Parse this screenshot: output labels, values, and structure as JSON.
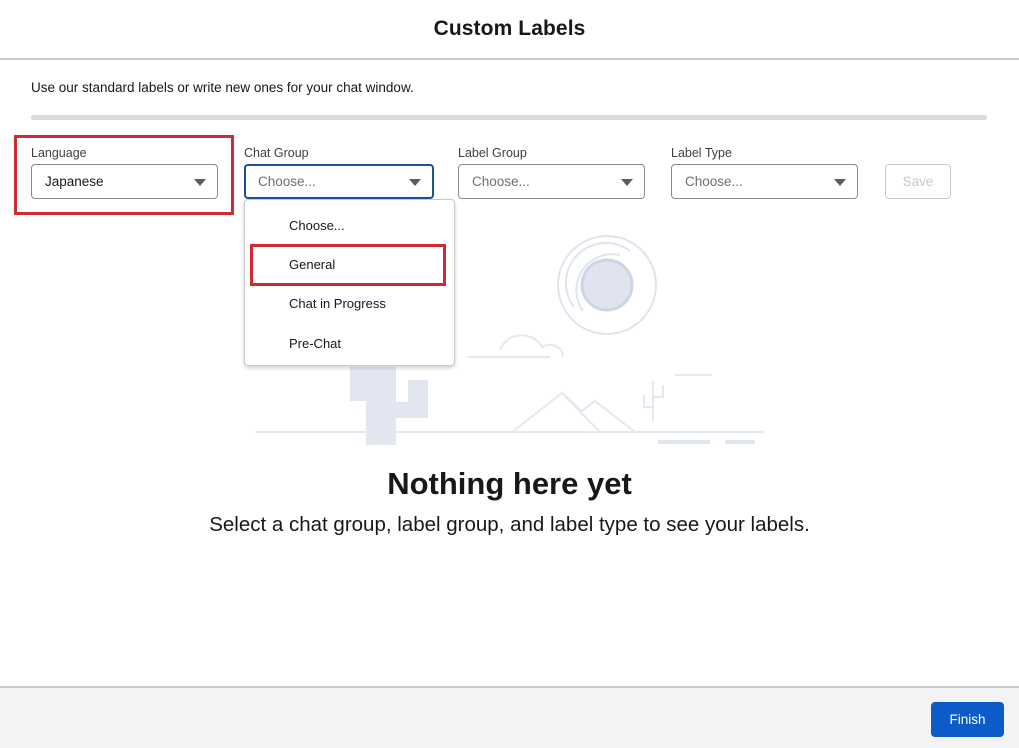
{
  "modal": {
    "title": "Custom Labels"
  },
  "intro": {
    "text": "Use our standard labels or write new ones for your chat window."
  },
  "filters": {
    "language": {
      "label": "Language",
      "value": "Japanese"
    },
    "chat_group": {
      "label": "Chat Group",
      "value": "Choose..."
    },
    "label_group": {
      "label": "Label Group",
      "value": "Choose..."
    },
    "label_type": {
      "label": "Label Type",
      "value": "Choose..."
    },
    "save_label": "Save"
  },
  "chat_group_dropdown": {
    "options": [
      "Choose...",
      "General",
      "Chat in Progress",
      "Pre-Chat"
    ],
    "highlighted_option": "General"
  },
  "empty_state": {
    "title": "Nothing here yet",
    "subtitle": "Select a chat group, label group, and label type to see your labels."
  },
  "footer": {
    "finish_label": "Finish"
  },
  "colors": {
    "highlight": "#d12a33",
    "focus_border": "#1b5297",
    "primary_button": "#0b5cc9",
    "illustration": "#dfe4ef"
  },
  "icons": {
    "select_caret": "triangle-down-icon"
  }
}
